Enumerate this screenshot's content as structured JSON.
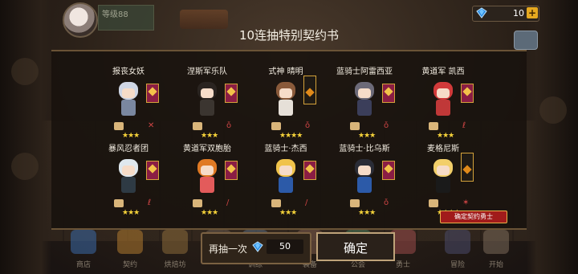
{
  "topbar": {
    "level_text": "等级88",
    "level_sub": "",
    "gem_count": "10",
    "plus_label": "+"
  },
  "dialog": {
    "title": "10连抽特别契约书",
    "contract_tag": "确定契约勇士",
    "redraw_label": "再抽一次",
    "redraw_cost": "50",
    "confirm_label": "确定"
  },
  "heroes": [
    {
      "name": "报丧女妖",
      "stars": "★★★",
      "hair": "#cfd6e4",
      "outfit": "#7a87a0",
      "weapon": "✕"
    },
    {
      "name": "涅斯军乐队",
      "stars": "★★★",
      "hair": "#2a2420",
      "outfit": "#3b3530",
      "weapon": "ǒ"
    },
    {
      "name": "式神 晴明",
      "stars": "★★★★",
      "hair": "#8a5a3a",
      "outfit": "#e6e0d8",
      "weapon": "ǒ"
    },
    {
      "name": "蓝骑士阿雷西亚",
      "stars": "★★★",
      "hair": "#6c6a78",
      "outfit": "#3b3e5a",
      "weapon": "ǒ"
    },
    {
      "name": "黄道军 凯西",
      "stars": "★★★",
      "hair": "#d13a3a",
      "outfit": "#c03838",
      "weapon": "ℓ"
    },
    {
      "name": "暴风忍者团",
      "stars": "★★★",
      "hair": "#dfe8ee",
      "outfit": "#2e3a44",
      "weapon": "ℓ"
    },
    {
      "name": "黄道军双胞胎",
      "stars": "★★★",
      "hair": "#e07a24",
      "outfit": "#e35b5b",
      "weapon": "/"
    },
    {
      "name": "蓝骑士·杰西",
      "stars": "★★★",
      "hair": "#f0c34a",
      "outfit": "#2c5aa8",
      "weapon": "/"
    },
    {
      "name": "蓝骑士·比乌斯",
      "stars": "★★★",
      "hair": "#2a2c36",
      "outfit": "#2c5aa8",
      "weapon": "ǒ"
    },
    {
      "name": "麦格尼斯",
      "stars": "★★★★",
      "hair": "#f2cf6a",
      "outfit": "#1a1a1a",
      "weapon": "✶"
    }
  ],
  "dock": [
    {
      "label": "商店"
    },
    {
      "label": "契约"
    },
    {
      "label": "烘焙坊"
    },
    {
      "label": ""
    },
    {
      "label": "训练"
    },
    {
      "label": "装备"
    },
    {
      "label": "公会"
    },
    {
      "label": "勇士"
    },
    {
      "label": "冒险"
    },
    {
      "label": "开始"
    }
  ],
  "colors": {
    "gem": "#2f8de0",
    "gold_star": "#f5d23a",
    "banner_red": "#8a1d44",
    "tag_red": "#a11b1b"
  }
}
